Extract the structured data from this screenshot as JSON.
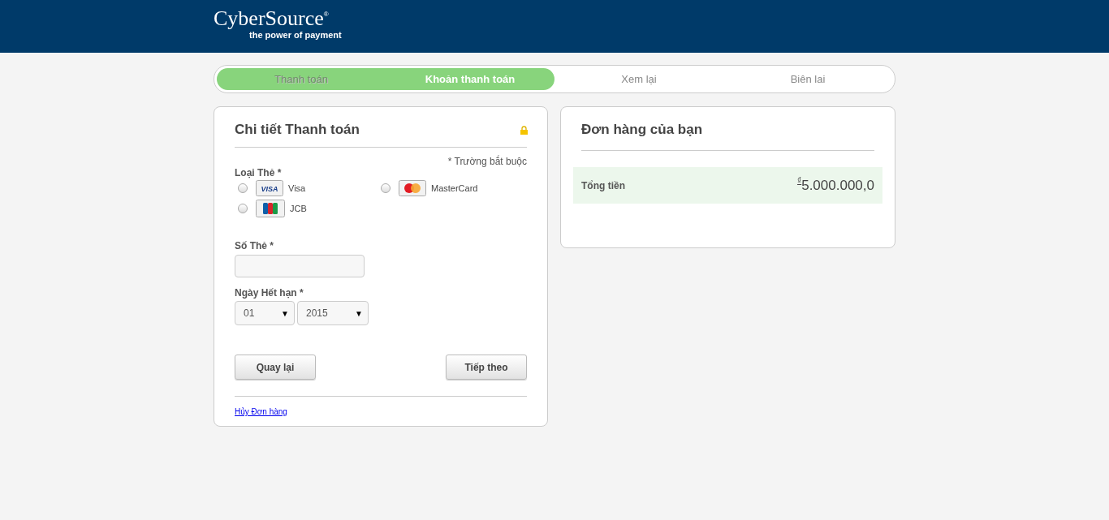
{
  "header": {
    "logo": "CyberSource",
    "logo_mark": "®",
    "tagline": "the power of payment"
  },
  "steps": [
    {
      "label": "Thanh toán",
      "completed": true,
      "selected": false
    },
    {
      "label": "Khoản thanh toán",
      "completed": false,
      "selected": true
    },
    {
      "label": "Xem lại",
      "completed": false,
      "selected": false
    },
    {
      "label": "Biên lai",
      "completed": false,
      "selected": false
    }
  ],
  "payment": {
    "title": "Chi tiết Thanh toán",
    "required_note": "* Trường bắt buộc",
    "card_type_label": "Loại Thẻ *",
    "card_types": [
      {
        "kind": "visa",
        "logo_text": "VISA",
        "label": "Visa",
        "selected": false
      },
      {
        "kind": "mastercard",
        "label": "MasterCard",
        "selected": false
      },
      {
        "kind": "jcb",
        "label": "JCB",
        "selected": false
      }
    ],
    "card_number_label": "Số Thẻ *",
    "expiry_label": "Ngày Hết hạn *",
    "expiry_month": {
      "value": "01",
      "caret": "▼"
    },
    "expiry_year": {
      "value": "2015",
      "caret": "▼"
    },
    "buttons": [
      "Quay lại",
      "Tiếp theo"
    ],
    "cancel_link": "Hủy Đơn hàng"
  },
  "order": {
    "title": "Đơn hàng của bạn",
    "total_label": "Tổng tiền",
    "currency": "₫",
    "total": "5.000.000,0"
  }
}
